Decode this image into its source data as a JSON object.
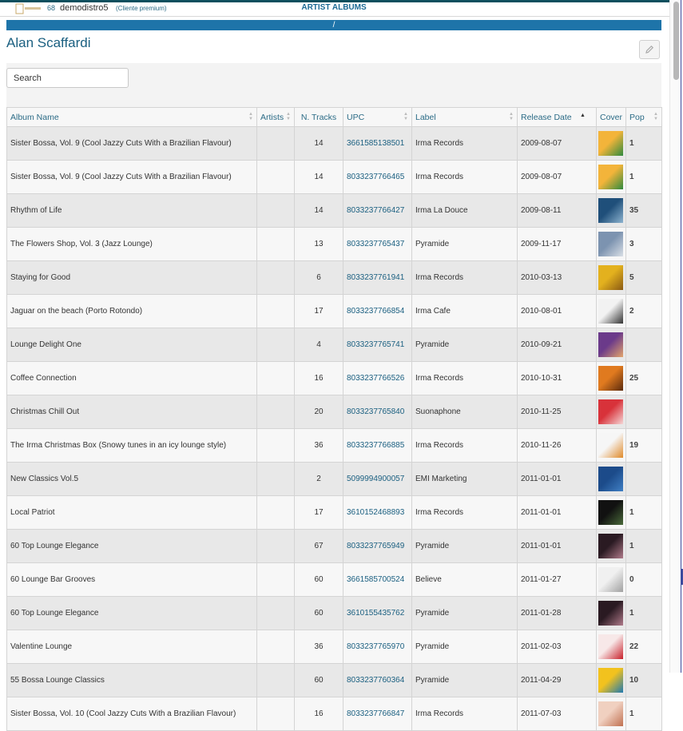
{
  "header": {
    "count": "68",
    "user": "demodistro5",
    "user_type": "(Cliente premium)",
    "page_title": "ARTIST ALBUMS"
  },
  "bluebar": {
    "text": "/"
  },
  "artist_name": "Alan Scaffardi",
  "search": {
    "placeholder": "Search",
    "value": ""
  },
  "table": {
    "columns": [
      "Album Name",
      "Artists",
      "N. Tracks",
      "UPC",
      "Label",
      "Release Date",
      "Cover",
      "Pop"
    ],
    "sorted_by": "Release Date",
    "sort_direction": "ascending",
    "rows": [
      {
        "album": "Sister Bossa, Vol. 9 (Cool Jazzy Cuts With a Brazilian Flavour)",
        "artists": "",
        "tracks": "14",
        "upc": "3661585138501",
        "label": "Irma Records",
        "date": "2009-08-07",
        "cover": [
          "#f3b43a",
          "#2f8a3e"
        ],
        "pop": "1"
      },
      {
        "album": "Sister Bossa, Vol. 9 (Cool Jazzy Cuts With a Brazilian Flavour)",
        "artists": "",
        "tracks": "14",
        "upc": "8033237766465",
        "label": "Irma Records",
        "date": "2009-08-07",
        "cover": [
          "#f3b43a",
          "#2f8a3e"
        ],
        "pop": "1"
      },
      {
        "album": "Rhythm of Life",
        "artists": "",
        "tracks": "14",
        "upc": "8033237766427",
        "label": "Irma La Douce",
        "date": "2009-08-11",
        "cover": [
          "#1f4f7a",
          "#8db3cf"
        ],
        "pop": "35"
      },
      {
        "album": "The Flowers Shop, Vol. 3 (Jazz Lounge)",
        "artists": "",
        "tracks": "13",
        "upc": "8033237765437",
        "label": "Pyramide",
        "date": "2009-11-17",
        "cover": [
          "#7c93b0",
          "#d9dfe6"
        ],
        "pop": "3"
      },
      {
        "album": "Staying for Good",
        "artists": "",
        "tracks": "6",
        "upc": "8033237761941",
        "label": "Irma Records",
        "date": "2010-03-13",
        "cover": [
          "#e3b11e",
          "#8a5a14"
        ],
        "pop": "5"
      },
      {
        "album": "Jaguar on the beach (Porto Rotondo)",
        "artists": "",
        "tracks": "17",
        "upc": "8033237766854",
        "label": "Irma Cafe",
        "date": "2010-08-01",
        "cover": [
          "#f2f2f2",
          "#333333"
        ],
        "pop": "2"
      },
      {
        "album": "Lounge Delight One",
        "artists": "",
        "tracks": "4",
        "upc": "8033237765741",
        "label": "Pyramide",
        "date": "2010-09-21",
        "cover": [
          "#6b3a8a",
          "#e3a46b"
        ],
        "pop": ""
      },
      {
        "album": "Coffee Connection",
        "artists": "",
        "tracks": "16",
        "upc": "8033237766526",
        "label": "Irma Records",
        "date": "2010-10-31",
        "cover": [
          "#e07a1f",
          "#5a2a0d"
        ],
        "pop": "25"
      },
      {
        "album": "Christmas Chill Out",
        "artists": "",
        "tracks": "20",
        "upc": "8033237765840",
        "label": "Suonaphone",
        "date": "2010-11-25",
        "cover": [
          "#d8323a",
          "#f5d6d6"
        ],
        "pop": ""
      },
      {
        "album": "The Irma Christmas Box (Snowy tunes in an icy lounge style)",
        "artists": "",
        "tracks": "36",
        "upc": "8033237766885",
        "label": "Irma Records",
        "date": "2010-11-26",
        "cover": [
          "#f6f6f6",
          "#e08a2a"
        ],
        "pop": "19"
      },
      {
        "album": "New Classics Vol.5",
        "artists": "",
        "tracks": "2",
        "upc": "5099994900057",
        "label": "EMI Marketing",
        "date": "2011-01-01",
        "cover": [
          "#1c4b8a",
          "#3f7fc4"
        ],
        "pop": ""
      },
      {
        "album": "Local Patriot",
        "artists": "",
        "tracks": "17",
        "upc": "3610152468893",
        "label": "Irma Records",
        "date": "2011-01-01",
        "cover": [
          "#111111",
          "#4a6a3a"
        ],
        "pop": "1"
      },
      {
        "album": "60 Top Lounge Elegance",
        "artists": "",
        "tracks": "67",
        "upc": "8033237765949",
        "label": "Pyramide",
        "date": "2011-01-01",
        "cover": [
          "#2a1a22",
          "#b07a8a"
        ],
        "pop": "1"
      },
      {
        "album": "60 Lounge Bar Grooves",
        "artists": "",
        "tracks": "60",
        "upc": "3661585700524",
        "label": "Believe",
        "date": "2011-01-27",
        "cover": [
          "#f0f0f0",
          "#a0a0a0"
        ],
        "pop": "0"
      },
      {
        "album": "60 Top Lounge Elegance",
        "artists": "",
        "tracks": "60",
        "upc": "3610155435762",
        "label": "Pyramide",
        "date": "2011-01-28",
        "cover": [
          "#2a1a22",
          "#b07a8a"
        ],
        "pop": "1"
      },
      {
        "album": "Valentine Lounge",
        "artists": "",
        "tracks": "36",
        "upc": "8033237765970",
        "label": "Pyramide",
        "date": "2011-02-03",
        "cover": [
          "#f7e8e8",
          "#c8202a"
        ],
        "pop": "22"
      },
      {
        "album": "55 Bossa Lounge Classics",
        "artists": "",
        "tracks": "60",
        "upc": "8033237760364",
        "label": "Pyramide",
        "date": "2011-04-29",
        "cover": [
          "#f2c21e",
          "#1f7ab0"
        ],
        "pop": "10"
      },
      {
        "album": "Sister Bossa, Vol. 10 (Cool Jazzy Cuts With a Brazilian Flavour)",
        "artists": "",
        "tracks": "16",
        "upc": "8033237766847",
        "label": "Irma Records",
        "date": "2011-07-03",
        "cover": [
          "#f0d0c0",
          "#c07050"
        ],
        "pop": "1"
      }
    ]
  }
}
